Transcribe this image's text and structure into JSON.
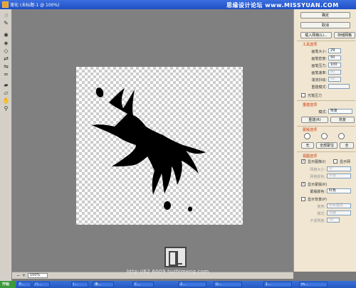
{
  "window": {
    "title": "液化 (未标题-1 @ 100%)",
    "site_watermark": "思缘设计论坛 www.MISSYUAN.COM"
  },
  "panel": {
    "ok": "确定",
    "cancel": "取消",
    "load_mesh": "载入网格(L)...",
    "save_mesh": "存储网格",
    "tool_options": {
      "title": "工具选项",
      "brush_size": {
        "label": "画笔大小:",
        "value": "29"
      },
      "brush_density": {
        "label": "画笔密度:",
        "value": "50"
      },
      "brush_pressure": {
        "label": "画笔压力:",
        "value": "100"
      },
      "brush_rate": {
        "label": "画笔速率:",
        "value": "80"
      },
      "turbulent_jitter": {
        "label": "湍流抖动:",
        "value": "50"
      },
      "reconstruct_mode": {
        "label": "重建模式:",
        "value": ""
      },
      "stylus_pressure": "光笔压力"
    },
    "reconstruct": {
      "title": "重建选项",
      "mode_label": "模式:",
      "mode_value": "恢复",
      "reconstruct_btn": "重建(R)",
      "restore_btn": "恢复"
    },
    "mask": {
      "title": "蒙版选项",
      "none_btn": "无",
      "mask_all_btn": "全部蒙住",
      "invert_btn": "全"
    },
    "view": {
      "title": "视图选项",
      "show_image": "显示图像(I)",
      "show_mesh": "显示网",
      "mesh_size_label": "网格大小:",
      "mesh_size_value": "中",
      "mesh_color_label": "网格颜色:",
      "mesh_color_value": "灰色",
      "show_mask": "显示蒙版(K)",
      "mask_color_label": "蒙版颜色:",
      "mask_color_value": "红色",
      "show_backdrop": "显示背景(P)",
      "use_label": "使用:",
      "use_value": "所有图层",
      "mode_label": "模式:",
      "mode_value": "前面",
      "opacity_label": "不透明度:",
      "opacity_value": "50"
    }
  },
  "status": {
    "zoom": "100%"
  },
  "taskbar": {
    "start": "开始",
    "tasks": [
      "P...",
      "八...",
      "I...",
      "未...",
      "C...",
      "2...",
      "U...",
      "1...",
      "m..."
    ]
  },
  "bottom_watermark": "http://62.6009.tuzhimeng.com",
  "colors": {
    "panel_bg": "#f0e6d2",
    "section_title": "#cc3300",
    "titlebar": "#2a5fd0"
  },
  "icons": [
    "warp-icon",
    "reconstruct-icon",
    "twirl-icon",
    "pucker-icon",
    "bloat-icon",
    "push-left-icon",
    "mirror-icon",
    "turbulence-icon",
    "freeze-mask-icon",
    "thaw-mask-icon",
    "hand-icon",
    "zoom-icon"
  ]
}
